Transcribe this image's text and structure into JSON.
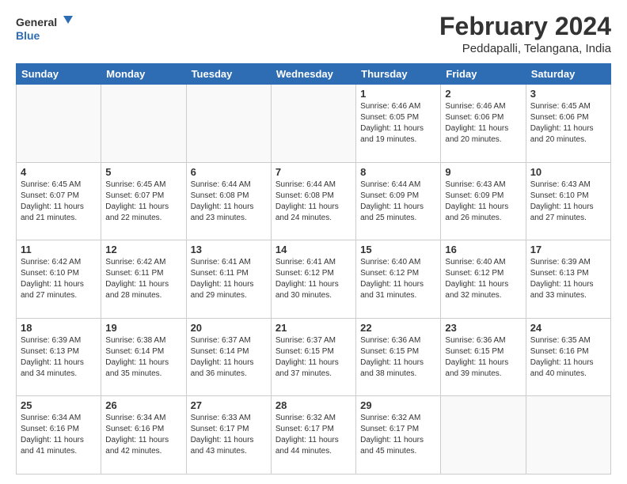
{
  "header": {
    "logo_general": "General",
    "logo_blue": "Blue",
    "title": "February 2024",
    "subtitle": "Peddapalli, Telangana, India"
  },
  "weekdays": [
    "Sunday",
    "Monday",
    "Tuesday",
    "Wednesday",
    "Thursday",
    "Friday",
    "Saturday"
  ],
  "weeks": [
    [
      {
        "day": "",
        "info": ""
      },
      {
        "day": "",
        "info": ""
      },
      {
        "day": "",
        "info": ""
      },
      {
        "day": "",
        "info": ""
      },
      {
        "day": "1",
        "info": "Sunrise: 6:46 AM\nSunset: 6:05 PM\nDaylight: 11 hours and 19 minutes."
      },
      {
        "day": "2",
        "info": "Sunrise: 6:46 AM\nSunset: 6:06 PM\nDaylight: 11 hours and 20 minutes."
      },
      {
        "day": "3",
        "info": "Sunrise: 6:45 AM\nSunset: 6:06 PM\nDaylight: 11 hours and 20 minutes."
      }
    ],
    [
      {
        "day": "4",
        "info": "Sunrise: 6:45 AM\nSunset: 6:07 PM\nDaylight: 11 hours and 21 minutes."
      },
      {
        "day": "5",
        "info": "Sunrise: 6:45 AM\nSunset: 6:07 PM\nDaylight: 11 hours and 22 minutes."
      },
      {
        "day": "6",
        "info": "Sunrise: 6:44 AM\nSunset: 6:08 PM\nDaylight: 11 hours and 23 minutes."
      },
      {
        "day": "7",
        "info": "Sunrise: 6:44 AM\nSunset: 6:08 PM\nDaylight: 11 hours and 24 minutes."
      },
      {
        "day": "8",
        "info": "Sunrise: 6:44 AM\nSunset: 6:09 PM\nDaylight: 11 hours and 25 minutes."
      },
      {
        "day": "9",
        "info": "Sunrise: 6:43 AM\nSunset: 6:09 PM\nDaylight: 11 hours and 26 minutes."
      },
      {
        "day": "10",
        "info": "Sunrise: 6:43 AM\nSunset: 6:10 PM\nDaylight: 11 hours and 27 minutes."
      }
    ],
    [
      {
        "day": "11",
        "info": "Sunrise: 6:42 AM\nSunset: 6:10 PM\nDaylight: 11 hours and 27 minutes."
      },
      {
        "day": "12",
        "info": "Sunrise: 6:42 AM\nSunset: 6:11 PM\nDaylight: 11 hours and 28 minutes."
      },
      {
        "day": "13",
        "info": "Sunrise: 6:41 AM\nSunset: 6:11 PM\nDaylight: 11 hours and 29 minutes."
      },
      {
        "day": "14",
        "info": "Sunrise: 6:41 AM\nSunset: 6:12 PM\nDaylight: 11 hours and 30 minutes."
      },
      {
        "day": "15",
        "info": "Sunrise: 6:40 AM\nSunset: 6:12 PM\nDaylight: 11 hours and 31 minutes."
      },
      {
        "day": "16",
        "info": "Sunrise: 6:40 AM\nSunset: 6:12 PM\nDaylight: 11 hours and 32 minutes."
      },
      {
        "day": "17",
        "info": "Sunrise: 6:39 AM\nSunset: 6:13 PM\nDaylight: 11 hours and 33 minutes."
      }
    ],
    [
      {
        "day": "18",
        "info": "Sunrise: 6:39 AM\nSunset: 6:13 PM\nDaylight: 11 hours and 34 minutes."
      },
      {
        "day": "19",
        "info": "Sunrise: 6:38 AM\nSunset: 6:14 PM\nDaylight: 11 hours and 35 minutes."
      },
      {
        "day": "20",
        "info": "Sunrise: 6:37 AM\nSunset: 6:14 PM\nDaylight: 11 hours and 36 minutes."
      },
      {
        "day": "21",
        "info": "Sunrise: 6:37 AM\nSunset: 6:15 PM\nDaylight: 11 hours and 37 minutes."
      },
      {
        "day": "22",
        "info": "Sunrise: 6:36 AM\nSunset: 6:15 PM\nDaylight: 11 hours and 38 minutes."
      },
      {
        "day": "23",
        "info": "Sunrise: 6:36 AM\nSunset: 6:15 PM\nDaylight: 11 hours and 39 minutes."
      },
      {
        "day": "24",
        "info": "Sunrise: 6:35 AM\nSunset: 6:16 PM\nDaylight: 11 hours and 40 minutes."
      }
    ],
    [
      {
        "day": "25",
        "info": "Sunrise: 6:34 AM\nSunset: 6:16 PM\nDaylight: 11 hours and 41 minutes."
      },
      {
        "day": "26",
        "info": "Sunrise: 6:34 AM\nSunset: 6:16 PM\nDaylight: 11 hours and 42 minutes."
      },
      {
        "day": "27",
        "info": "Sunrise: 6:33 AM\nSunset: 6:17 PM\nDaylight: 11 hours and 43 minutes."
      },
      {
        "day": "28",
        "info": "Sunrise: 6:32 AM\nSunset: 6:17 PM\nDaylight: 11 hours and 44 minutes."
      },
      {
        "day": "29",
        "info": "Sunrise: 6:32 AM\nSunset: 6:17 PM\nDaylight: 11 hours and 45 minutes."
      },
      {
        "day": "",
        "info": ""
      },
      {
        "day": "",
        "info": ""
      }
    ]
  ]
}
